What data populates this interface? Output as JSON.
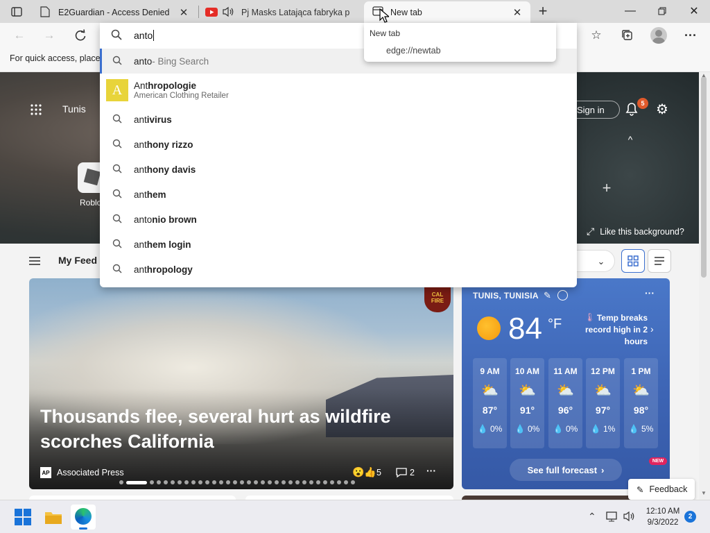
{
  "tabs": [
    {
      "title": "E2Guardian - Access Denied",
      "icon": "page-icon"
    },
    {
      "title": "Pj Masks Latająca fabryka p",
      "icon": "youtube-icon"
    },
    {
      "title": "New tab",
      "icon": "newtab-icon"
    }
  ],
  "tab_tooltip": {
    "title": "New tab",
    "url": "edge://newtab"
  },
  "omnibox": {
    "value": "anto"
  },
  "suggestions": [
    {
      "prefix": "anto",
      "rest": "",
      "suffix": " - Bing Search",
      "type": "bing"
    },
    {
      "prefix": "Ant",
      "rest": "hropologie",
      "subtitle": "American Clothing Retailer",
      "type": "entity"
    },
    {
      "prefix": "ant",
      "rest": "ivirus"
    },
    {
      "prefix": "ant",
      "rest": "hony rizzo"
    },
    {
      "prefix": "ant",
      "rest": "hony davis"
    },
    {
      "prefix": "ant",
      "rest": "hem"
    },
    {
      "prefix": "anto",
      "rest": "nio brown"
    },
    {
      "prefix": "ant",
      "rest": "hem login"
    },
    {
      "prefix": "ant",
      "rest": "hropology"
    }
  ],
  "favbar": {
    "hint": "For quick access, place y"
  },
  "newtab": {
    "location": "Tunis",
    "sign_in": "Sign in",
    "notification_count": "5",
    "tile_label": "Roblo",
    "like_background": "Like this background?",
    "feed_label": "My Feed"
  },
  "article": {
    "headline": "Thousands flee, several hurt as wildfire scorches California",
    "source": "Associated Press",
    "source_badge": "AP",
    "reactions": "5",
    "comments": "2"
  },
  "weather": {
    "location": "TUNIS, TUNISIA",
    "temp": "84",
    "unit": "°F",
    "alert": "Temp breaks record high in 2 hours",
    "hours": [
      {
        "time": "9 AM",
        "temp": "87°",
        "precip": "0%"
      },
      {
        "time": "10 AM",
        "temp": "91°",
        "precip": "0%"
      },
      {
        "time": "11 AM",
        "temp": "96°",
        "precip": "0%"
      },
      {
        "time": "12 PM",
        "temp": "97°",
        "precip": "1%"
      },
      {
        "time": "1 PM",
        "temp": "98°",
        "precip": "5%"
      }
    ],
    "forecast_button": "See full forecast",
    "new_badge": "NEW"
  },
  "feedback": "Feedback",
  "taskbar": {
    "time": "12:10 AM",
    "date": "9/3/2022",
    "notif_count": "2"
  }
}
